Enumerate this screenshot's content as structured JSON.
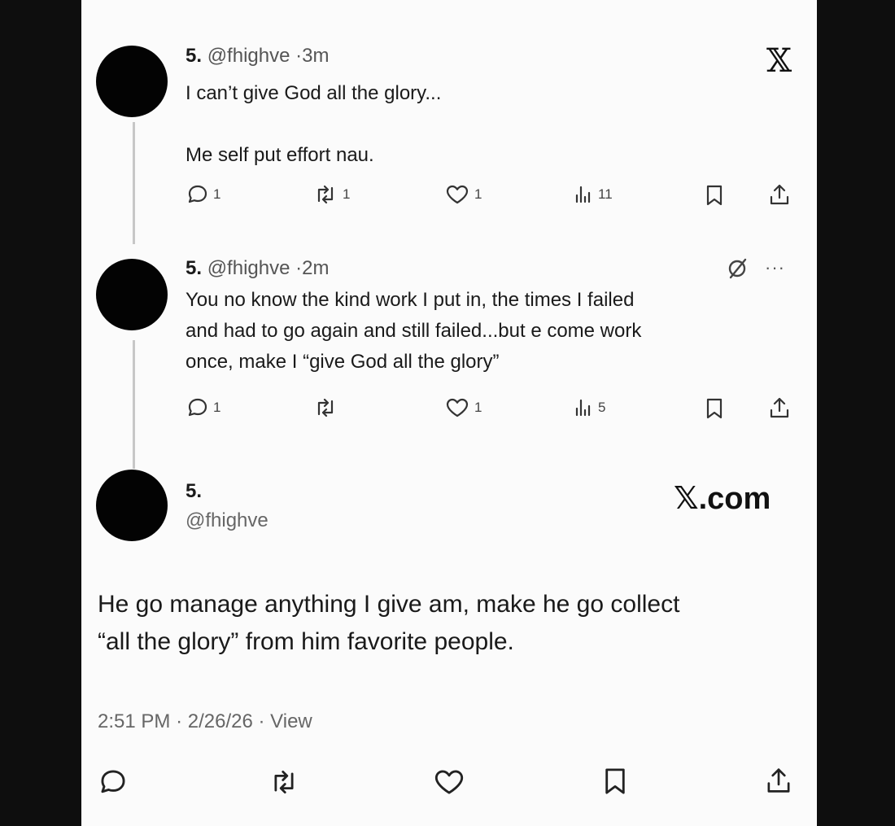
{
  "tweets": [
    {
      "number": "5.",
      "handle": "@fhighve",
      "separator": "·",
      "time": "3m",
      "lines": [
        "I can’t give God all the glory...",
        "",
        "Me self put effort nau."
      ],
      "counts": {
        "replies": "1",
        "reposts": "1",
        "likes": "1",
        "views": "11"
      }
    },
    {
      "number": "5.",
      "handle": "@fhighve",
      "separator": "·",
      "time": "2m",
      "lines": [
        "You no know the kind work I put in, the times I failed",
        "and had to go again and still failed...but e come work",
        "once, make I “give God all the glory”"
      ],
      "counts": {
        "replies": "1",
        "reposts": "",
        "likes": "1",
        "views": "5"
      },
      "more": "···"
    }
  ],
  "main_post": {
    "name": "5.",
    "handle": "@fhighve",
    "lines": [
      "He go manage anything I give am, make he go collect",
      "“all the glory” from him favorite people."
    ],
    "time": "2:51 PM",
    "date": "2/26/26",
    "view_label": "View",
    "separator": "·"
  },
  "branding": {
    "x_logo": "𝕏",
    "x_com": "𝕏.com"
  },
  "icons": [
    "reply-icon",
    "repost-icon",
    "like-icon",
    "views-icon",
    "bookmark-icon",
    "share-icon",
    "grok-icon",
    "more-icon"
  ],
  "colors": {
    "background": "#0e0e0e",
    "card": "#fbfbfb",
    "text": "#1a1a1a",
    "muted": "#555555",
    "avatar": "#030303",
    "thread_line": "#c7c7c7"
  }
}
